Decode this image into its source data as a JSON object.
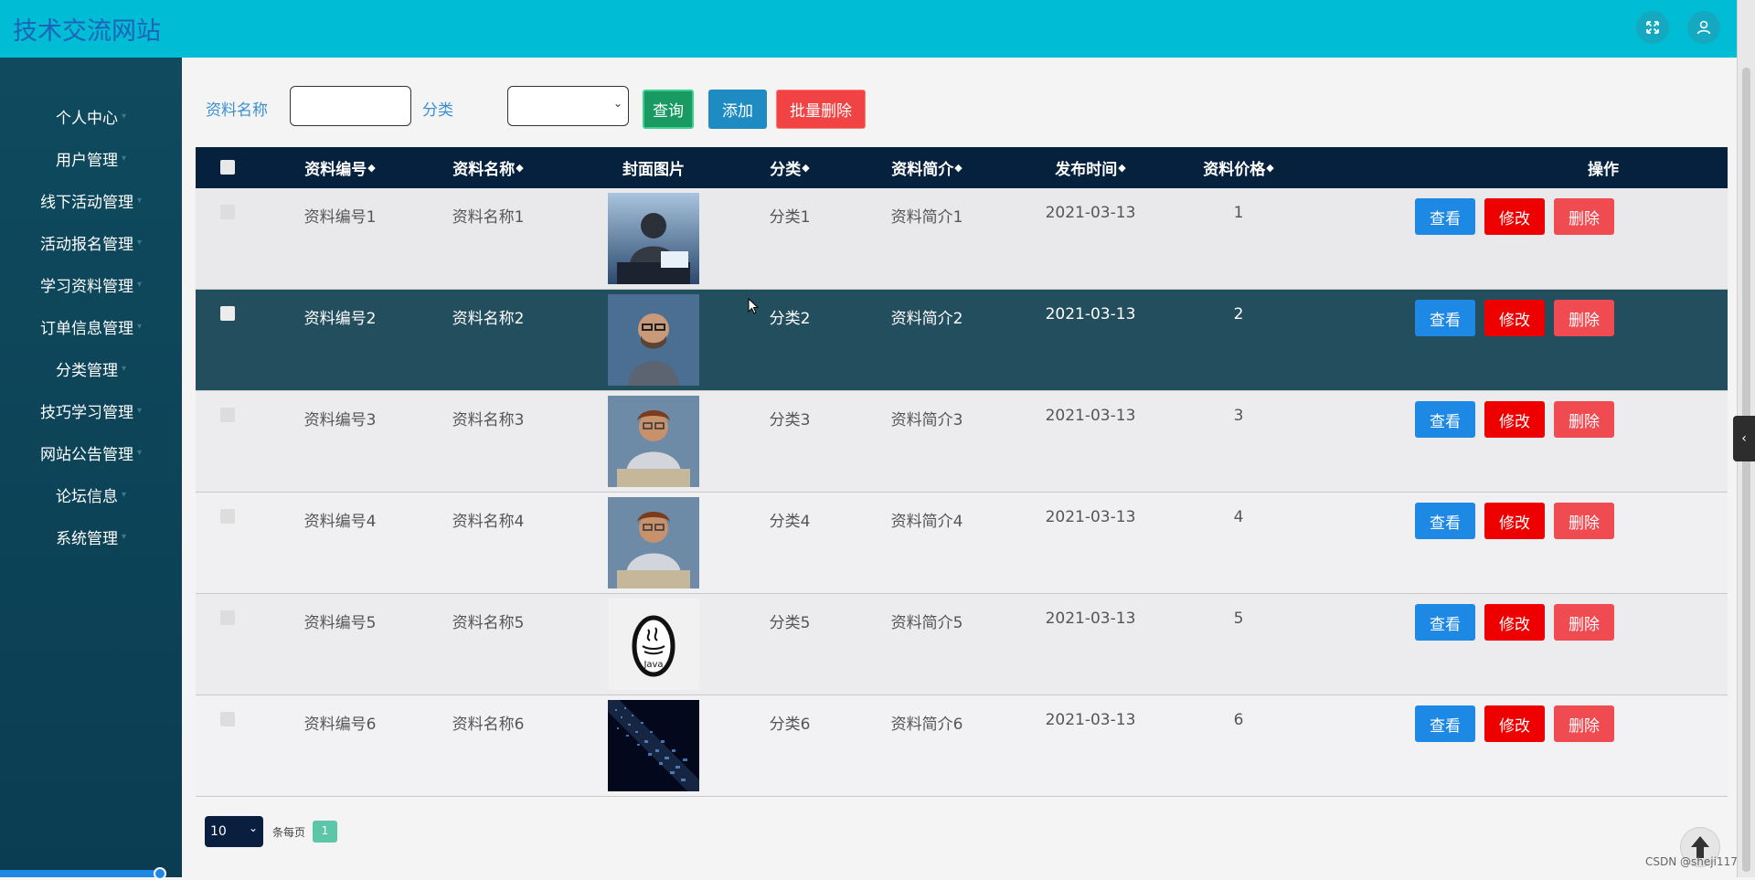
{
  "header": {
    "site_title": "技术交流网站",
    "fullscreen_icon": "expand-icon",
    "user_icon": "user-icon"
  },
  "sidebar": {
    "items": [
      {
        "label": "个人中心"
      },
      {
        "label": "用户管理"
      },
      {
        "label": "线下活动管理"
      },
      {
        "label": "活动报名管理"
      },
      {
        "label": "学习资料管理"
      },
      {
        "label": "订单信息管理"
      },
      {
        "label": "分类管理"
      },
      {
        "label": "技巧学习管理"
      },
      {
        "label": "网站公告管理"
      },
      {
        "label": "论坛信息"
      },
      {
        "label": "系统管理"
      }
    ]
  },
  "search": {
    "name_label": "资料名称",
    "name_value": "",
    "category_label": "分类",
    "category_value": "",
    "query_button": "查询",
    "add_button": "添加",
    "batch_delete_button": "批量删除"
  },
  "table": {
    "columns": [
      "资料编号",
      "资料名称",
      "封面图片",
      "分类",
      "资料简介",
      "发布时间",
      "资料价格",
      "操作"
    ],
    "rows": [
      {
        "code": "资料编号1",
        "name": "资料名称1",
        "image": "hooded-hacker-photo",
        "category": "分类1",
        "intro": "资料简介1",
        "date": "2021-03-13",
        "price": "1"
      },
      {
        "code": "资料编号2",
        "name": "资料名称2",
        "image": "man-with-glasses-photo",
        "category": "分类2",
        "intro": "资料简介2",
        "date": "2021-03-13",
        "price": "2"
      },
      {
        "code": "资料编号3",
        "name": "资料名称3",
        "image": "boy-at-keyboard-photo",
        "category": "分类3",
        "intro": "资料简介3",
        "date": "2021-03-13",
        "price": "3"
      },
      {
        "code": "资料编号4",
        "name": "资料名称4",
        "image": "boy-at-keyboard-photo",
        "category": "分类4",
        "intro": "资料简介4",
        "date": "2021-03-13",
        "price": "4"
      },
      {
        "code": "资料编号5",
        "name": "资料名称5",
        "image": "java-logo",
        "category": "分类5",
        "intro": "资料简介5",
        "date": "2021-03-13",
        "price": "5"
      },
      {
        "code": "资料编号6",
        "name": "资料名称6",
        "image": "binary-code-photo",
        "category": "分类6",
        "intro": "资料简介6",
        "date": "2021-03-13",
        "price": "6"
      }
    ],
    "actions": {
      "view": "查看",
      "edit": "修改",
      "delete": "删除"
    },
    "highlighted_row": 2
  },
  "pagination": {
    "page_size": "10",
    "per_page_label": "条每页",
    "current_page": "1"
  },
  "footer": {
    "watermark": "CSDN @sheji117",
    "java_logo_text": "Java"
  },
  "colors": {
    "topbar": "#00bcd4",
    "sidebar": "#0d4557",
    "table_header": "#06213d",
    "row_highlight": "#234e5e",
    "view_button": "#1e88e5",
    "edit_button": "#ee0000",
    "delete_button": "#f14b52",
    "query_button": "#1a9a63",
    "add_button": "#1e8bc3",
    "batch_delete_button": "#f14343"
  }
}
